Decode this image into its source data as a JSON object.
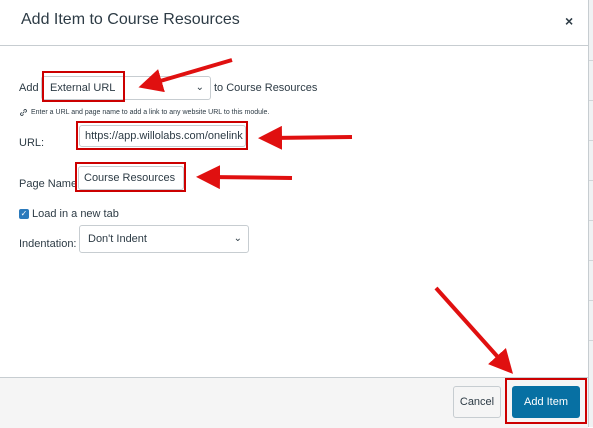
{
  "dialog": {
    "title": "Add Item to Course Resources",
    "close_label": "×"
  },
  "form": {
    "add_label": "Add",
    "type_select": {
      "value": "External URL"
    },
    "to_label": "to Course Resources",
    "hint": "Enter a URL and page name to add a link to any website URL to this module.",
    "url_label": "URL:",
    "url_value": "https://app.willolabs.com/onelink",
    "page_name_label": "Page Name:",
    "page_name_value": "Course Resources",
    "new_tab_label": "Load in a new tab",
    "new_tab_checked": true,
    "indentation_label": "Indentation:",
    "indentation_value": "Don't Indent"
  },
  "footer": {
    "cancel_label": "Cancel",
    "add_label": "Add Item"
  },
  "colors": {
    "annotation_red": "#cc0000",
    "primary_button": "#0770a3",
    "checkbox": "#2b7abc"
  }
}
